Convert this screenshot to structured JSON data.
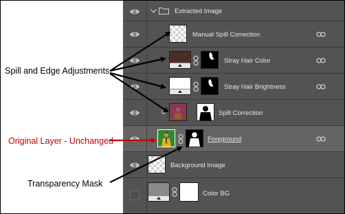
{
  "layers_panel": {
    "group": {
      "name": "Extracted Image"
    },
    "layers": [
      {
        "name": "Manual Spill Correction",
        "visible": true,
        "has_mask": false,
        "linked": true
      },
      {
        "name": "Stray Hair Color",
        "visible": true,
        "has_mask": true,
        "linked": true
      },
      {
        "name": "Stray Hair Brightness",
        "visible": true,
        "has_mask": true,
        "linked": true
      },
      {
        "name": "Spill Correction",
        "visible": true,
        "has_mask": true,
        "linked": false
      },
      {
        "name": "Foreground",
        "visible": true,
        "has_mask": true,
        "linked": true,
        "selected": true
      },
      {
        "name": "Background Image",
        "visible": true,
        "has_mask": false,
        "linked": false
      },
      {
        "name": "Color BG",
        "visible": false,
        "has_mask": true,
        "linked": false
      }
    ]
  },
  "annotations": {
    "spill_edge": "Spill and Edge Adjustments",
    "original_layer": "Original Layer - Unchanged",
    "transparency_mask": "Transparency Mask"
  },
  "colors": {
    "panel_bg": "#535353",
    "selected_row": "#646464",
    "annotation_red": "#c00000",
    "stray_hair_color_fill": "#4a2e26",
    "spill_correction_fill": "#8a3a50",
    "foreground_bg": "#2d8a2d"
  },
  "icons": {
    "visibility": "eye-icon",
    "folder": "folder-icon",
    "chain": "chain-link-icon",
    "linked": "link-icon"
  }
}
